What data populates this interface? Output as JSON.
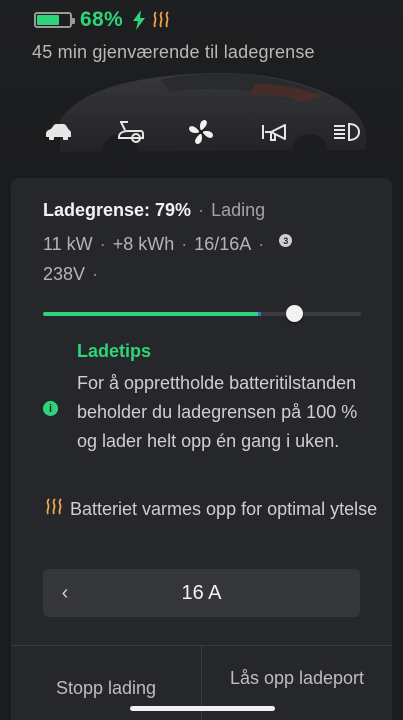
{
  "status": {
    "battery_level": 0.68,
    "battery_percent": "68%",
    "charging_icon": "lightning-bolt-icon",
    "heating_icon": "battery-heating-icon"
  },
  "remaining_text": "45 min gjenværende til ladegrense",
  "quick_controls": [
    {
      "name": "car-icon"
    },
    {
      "name": "charge-port-icon"
    },
    {
      "name": "fan-icon"
    },
    {
      "name": "horn-icon"
    },
    {
      "name": "headlights-icon"
    }
  ],
  "charge": {
    "limit_label": "Ladegrense: 79%",
    "state": "Lading",
    "power": "11 kW",
    "energy_added": "+8 kWh",
    "current": "16/16A",
    "phases": "3",
    "voltage": "238V",
    "limit_fraction": 0.79,
    "current_level": 0.68
  },
  "tip": {
    "title": "Ladetips",
    "body": "For å opprettholde batteritilstanden beholder du ladegrensen på 100 % og lader helt opp én gang i uken.",
    "info_icon": "i"
  },
  "heat_note": "Batteriet varmes opp for optimal ytelse",
  "amperage": {
    "prev_icon": "‹",
    "value": "16 A"
  },
  "actions": {
    "stop_label": "Stopp lading",
    "unlock_label": "Lås opp ladeport"
  },
  "colors": {
    "accent_green": "#2fd47a",
    "heat_orange": "#f0a848",
    "panel": "#26272a",
    "background": "#1b1c1e"
  }
}
